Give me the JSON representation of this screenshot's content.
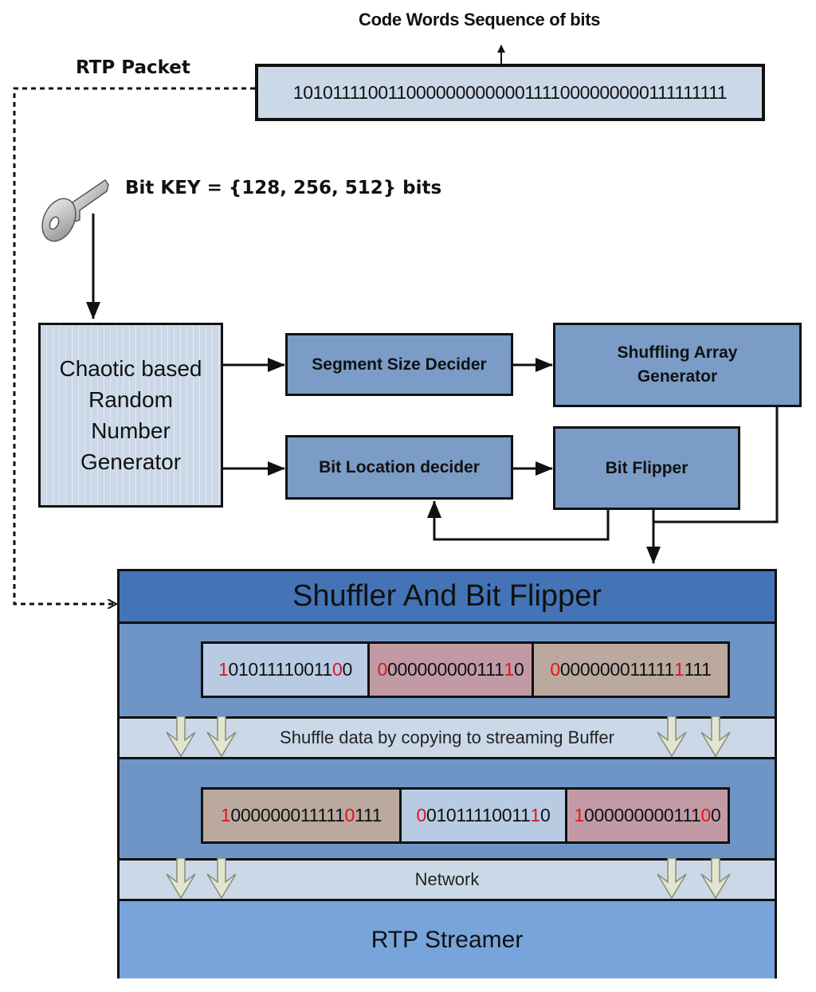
{
  "top": {
    "caption": "Code Words Sequence of bits",
    "bitstring": "1010111100110000000000001111000000000111111111"
  },
  "labels": {
    "rtp_packet": "RTP Packet",
    "bit_key": "Bit KEY = {128, 256, 512} bits"
  },
  "icons": {
    "key": "key-icon"
  },
  "blocks": {
    "rng_lines": [
      "Chaotic based",
      "Random",
      "Number",
      "Generator"
    ],
    "segment_size": "Segment Size Decider",
    "bit_location": "Bit Location decider",
    "shuffling_array_lines": [
      "Shuffling Array",
      "Generator"
    ],
    "bit_flipper": "Bit Flipper"
  },
  "shuffler": {
    "title": "Shuffler And Bit Flipper",
    "row_before": [
      {
        "color": "blue",
        "parts": [
          {
            "t": "1",
            "red": true
          },
          {
            "t": "01011110011",
            "red": false
          },
          {
            "t": "0",
            "red": true
          },
          {
            "t": "0",
            "red": false
          }
        ]
      },
      {
        "color": "pink",
        "parts": [
          {
            "t": "0",
            "red": true
          },
          {
            "t": "000000000111",
            "red": false
          },
          {
            "t": "1",
            "red": true
          },
          {
            "t": "0",
            "red": false
          }
        ]
      },
      {
        "color": "tan",
        "parts": [
          {
            "t": "0",
            "red": true
          },
          {
            "t": "000000011111",
            "red": false
          },
          {
            "t": "1",
            "red": true
          },
          {
            "t": "111",
            "red": false
          }
        ]
      }
    ],
    "shuffle_band": "Shuffle data by copying to streaming Buffer",
    "row_after": [
      {
        "color": "tan",
        "parts": [
          {
            "t": "1",
            "red": true
          },
          {
            "t": "000000011111",
            "red": false
          },
          {
            "t": "0",
            "red": true
          },
          {
            "t": "111",
            "red": false
          }
        ]
      },
      {
        "color": "blue",
        "parts": [
          {
            "t": "0",
            "red": true
          },
          {
            "t": "01011110011",
            "red": false
          },
          {
            "t": "1",
            "red": true
          },
          {
            "t": "0",
            "red": false
          }
        ]
      },
      {
        "color": "pink",
        "parts": [
          {
            "t": "1",
            "red": true
          },
          {
            "t": "000000000111",
            "red": false
          },
          {
            "t": "0",
            "red": true
          },
          {
            "t": "0",
            "red": false
          }
        ]
      }
    ],
    "network_band": "Network",
    "streamer": "RTP Streamer"
  },
  "colors": {
    "flip_bit": "#e0141a",
    "block_fill": "#7a9cc6",
    "header_fill": "#4474b6",
    "streamer_fill": "#78a4dc",
    "band_fill": "#cbd8e8"
  }
}
